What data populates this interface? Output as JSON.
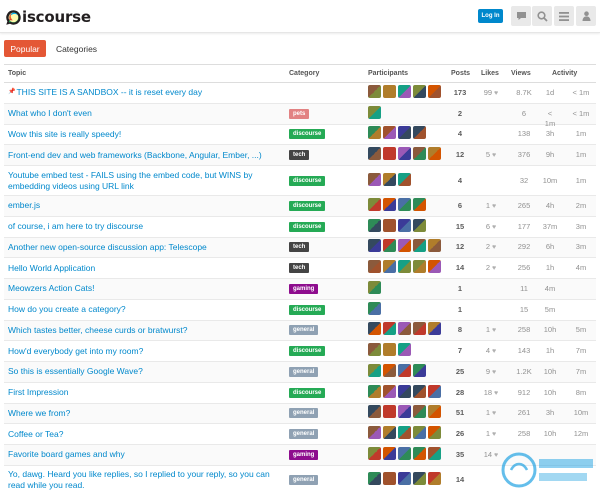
{
  "header": {
    "logo_text": "iscourse",
    "login_label": "Log In",
    "icons": [
      "chat-icon",
      "search-icon",
      "menu-icon",
      "user-icon"
    ]
  },
  "nav": {
    "tabs": [
      {
        "label": "Popular",
        "active": true
      },
      {
        "label": "Categories",
        "active": false
      }
    ]
  },
  "columns": [
    "Topic",
    "Category",
    "Participants",
    "Posts",
    "Likes",
    "Views",
    "Activity"
  ],
  "categories": {
    "pets": "#e28283",
    "discourse": "#25aa55",
    "tech": "#444444",
    "gaming": "#8e0d8e",
    "general": "#8fa1b3"
  },
  "topics": [
    {
      "title": "THIS SITE IS A SANDBOX -- it is reset every day",
      "pinned": true,
      "category": "",
      "avatars": 5,
      "posts": "173",
      "likes": "99",
      "views": "8.7K",
      "act1": "1d",
      "act2": "< 1m"
    },
    {
      "title": "What who I don't even",
      "category": "pets",
      "avatars": 1,
      "posts": "2",
      "likes": "",
      "views": "6",
      "act1": "< 1m",
      "act2": "< 1m"
    },
    {
      "title": "Wow this site is really speedy!",
      "category": "discourse",
      "avatars": 4,
      "posts": "4",
      "likes": "",
      "views": "138",
      "act1": "3h",
      "act2": "1m"
    },
    {
      "title": "Front-end dev and web frameworks (Backbone, Angular, Ember, ...)",
      "category": "tech",
      "avatars": 5,
      "posts": "12",
      "likes": "5",
      "views": "376",
      "act1": "9h",
      "act2": "1m"
    },
    {
      "title": "Youtube embed test - FAILS using the embed code, but WINS by embedding videos using URL link",
      "category": "discourse",
      "avatars": 3,
      "posts": "4",
      "likes": "",
      "views": "32",
      "act1": "10m",
      "act2": "1m",
      "tall": true
    },
    {
      "title": "ember.js",
      "category": "discourse",
      "avatars": 4,
      "posts": "6",
      "likes": "1",
      "views": "265",
      "act1": "4h",
      "act2": "2m"
    },
    {
      "title": "of course, i am here to try discourse",
      "category": "discourse",
      "avatars": 4,
      "posts": "15",
      "likes": "6",
      "views": "177",
      "act1": "37m",
      "act2": "3m"
    },
    {
      "title": "Another new open-source discussion app: Telescope",
      "category": "tech",
      "avatars": 5,
      "posts": "12",
      "likes": "2",
      "views": "292",
      "act1": "6h",
      "act2": "3m"
    },
    {
      "title": "Hello World Application",
      "category": "tech",
      "avatars": 5,
      "posts": "14",
      "likes": "2",
      "views": "256",
      "act1": "1h",
      "act2": "4m"
    },
    {
      "title": "Meowzers Action Cats!",
      "category": "gaming",
      "avatars": 1,
      "posts": "1",
      "likes": "",
      "views": "11",
      "act1": "4m",
      "act2": ""
    },
    {
      "title": "How do you create a category?",
      "category": "discourse",
      "avatars": 1,
      "posts": "1",
      "likes": "",
      "views": "15",
      "act1": "5m",
      "act2": ""
    },
    {
      "title": "Which tastes better, cheese curds or bratwurst?",
      "category": "general",
      "avatars": 5,
      "posts": "8",
      "likes": "1",
      "views": "258",
      "act1": "10h",
      "act2": "5m"
    },
    {
      "title": "How'd everybody get into my room?",
      "category": "discourse",
      "avatars": 3,
      "posts": "7",
      "likes": "4",
      "views": "143",
      "act1": "1h",
      "act2": "7m"
    },
    {
      "title": "So this is essentially Google Wave?",
      "category": "general",
      "avatars": 4,
      "posts": "25",
      "likes": "9",
      "views": "1.2K",
      "act1": "10h",
      "act2": "7m"
    },
    {
      "title": "First Impression",
      "category": "discourse",
      "avatars": 5,
      "posts": "28",
      "likes": "18",
      "views": "912",
      "act1": "10h",
      "act2": "8m"
    },
    {
      "title": "Where we from?",
      "category": "general",
      "avatars": 5,
      "posts": "51",
      "likes": "1",
      "views": "261",
      "act1": "3h",
      "act2": "10m"
    },
    {
      "title": "Coffee or Tea?",
      "category": "general",
      "avatars": 5,
      "posts": "26",
      "likes": "1",
      "views": "258",
      "act1": "10h",
      "act2": "12m"
    },
    {
      "title": "Favorite board games and why",
      "category": "gaming",
      "avatars": 5,
      "posts": "35",
      "likes": "14",
      "views": "",
      "act1": "",
      "act2": ""
    },
    {
      "title": "Yo, dawg. Heard you like replies, so I replied to your reply, so you can read while you read.",
      "category": "general",
      "avatars": 5,
      "posts": "14",
      "likes": "",
      "views": "",
      "act1": "",
      "act2": "",
      "tall": true
    }
  ],
  "colors": {
    "accent": "#e45735",
    "link": "#0088cc"
  }
}
